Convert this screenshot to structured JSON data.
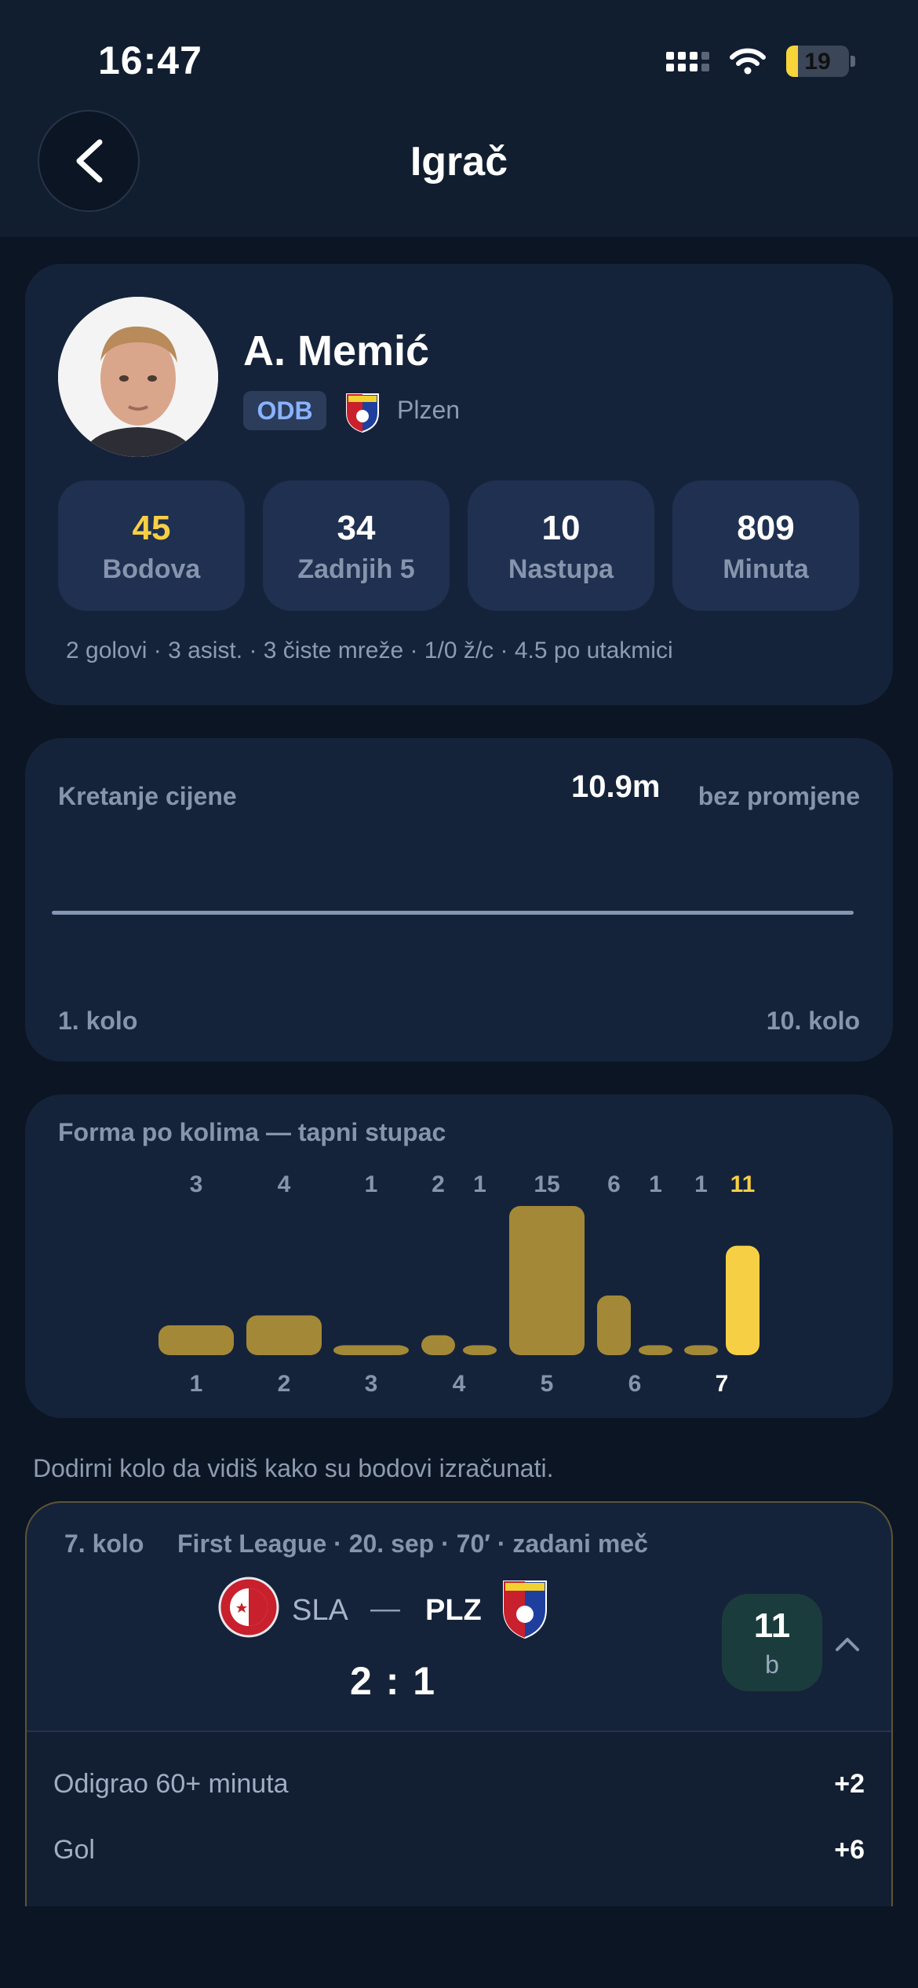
{
  "status_bar": {
    "time": "16:47",
    "battery": "19",
    "battery_level": 0.19
  },
  "header": {
    "title": "Igrač"
  },
  "player": {
    "name": "A. Memić",
    "position": "ODB",
    "club": "Plzen",
    "stats": [
      {
        "value": "45",
        "label": "Bodova"
      },
      {
        "value": "34",
        "label": "Zadnjih 5"
      },
      {
        "value": "10",
        "label": "Nastupa"
      },
      {
        "value": "809",
        "label": "Minuta"
      }
    ],
    "summary": "2 golovi · 3 asist. · 3 čiste mreže · 1/0 ž/c · 4.5 po utakmici"
  },
  "price_chart": {
    "title": "Kretanje cijene",
    "price": "10.9m",
    "change": "bez promjene",
    "x_start": "1. kolo",
    "x_end": "10. kolo"
  },
  "chart_data": {
    "type": "bar",
    "title": "Forma po kolima — tapni stupac",
    "categories": [
      "1",
      "2",
      "3",
      "4",
      "5",
      "6",
      "7"
    ],
    "values": [
      3,
      4,
      1,
      2,
      1,
      15,
      6,
      1,
      1,
      11
    ],
    "bar_rounds": [
      1,
      2,
      3,
      4,
      4,
      5,
      6,
      6,
      7,
      7
    ],
    "selected_round": "7",
    "colors": {
      "bar": "#a38937",
      "selected": "#f7cf45"
    }
  },
  "hint": "Dodirni kolo da vidiš kako su bodovi izračunati.",
  "match": {
    "round": "7. kolo",
    "info": "First League · 20. sep · 70′ · zadani meč",
    "home": "SLA",
    "separator": "—",
    "away": "PLZ",
    "score": "2 : 1",
    "points": "11",
    "points_unit": "b",
    "breakdown": [
      {
        "label": "Odigrao 60+ minuta",
        "points": "+2"
      },
      {
        "label": "Gol",
        "points": "+6"
      }
    ]
  }
}
